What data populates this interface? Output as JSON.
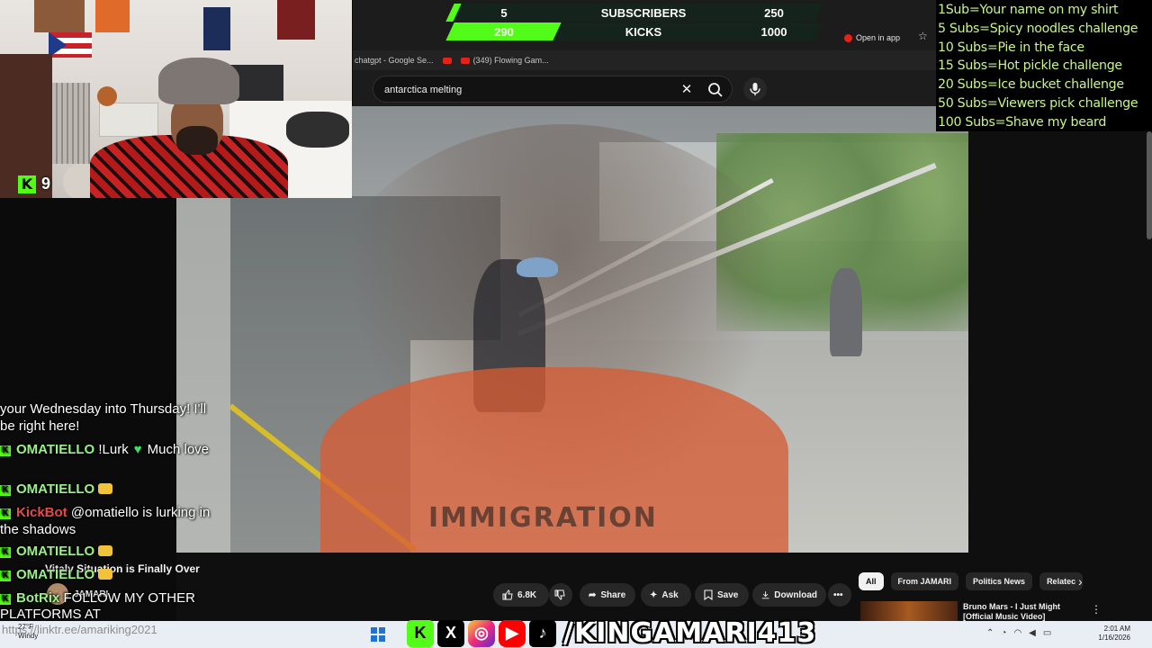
{
  "goal_widget": {
    "subscribers": {
      "current": "5",
      "label": "SUBSCRIBERS",
      "target": "250",
      "progress": 0.02
    },
    "kicks": {
      "current": "290",
      "label": "KICKS",
      "target": "1000",
      "progress": 0.29
    }
  },
  "browser": {
    "bookmarks": [
      {
        "label": "chatgpt - Google Se..."
      },
      {
        "label": ""
      },
      {
        "label": "(349) Flowing Gam..."
      }
    ],
    "open_in_app": "Open in app"
  },
  "search": {
    "value": "antarctica melting",
    "placeholder": "Search"
  },
  "webcam": {
    "viewer_count": "9"
  },
  "goals_list": [
    "1Sub=Your name on my shirt",
    "5 Subs=Spicy noodles challenge",
    "10 Subs=Pie in the face",
    "15 Subs=Hot pickle challenge",
    "20 Subs=Ice bucket challenge",
    "50 Subs=Viewers pick challenge",
    "100 Subs=Shave my beard"
  ],
  "video": {
    "shirt_text": "IMMIGRATION",
    "title": "Vitaly Situation is Finally Over",
    "channel": "JAMARI"
  },
  "chat": {
    "lines": [
      {
        "text": "your Wednesday into Thursday! I'll"
      },
      {
        "text": "be right here!"
      },
      {
        "name": "OMATIELLO",
        "text": "!Lurk",
        "text2": "Much love",
        "name_color": "#9bf08a"
      },
      {
        "name": "OMATIELLO",
        "text": "",
        "name_color": "#9bf08a"
      },
      {
        "name": "KickBot",
        "text": "@omatiello is lurking in",
        "name_color": "#e84a4a"
      },
      {
        "text": "the shadows"
      },
      {
        "name": "OMATIELLO",
        "text": "",
        "name_color": "#9bf08a"
      },
      {
        "name": "OMATIELLO",
        "text": "",
        "name_color": "#9bf08a"
      },
      {
        "name": "BotRix",
        "text": "FOLLOW MY OTHER",
        "name_color": "#9bf08a"
      },
      {
        "text": "PLATFORMS AT"
      },
      {
        "text": "https://linktr.ee/amariking2021"
      }
    ]
  },
  "actions": {
    "like": "6.8K",
    "share": "Share",
    "ask": "Ask",
    "save": "Save",
    "download": "Download"
  },
  "chips": [
    "All",
    "From JAMARI",
    "Politics News",
    "Relatec"
  ],
  "related": {
    "title": "Bruno Mars - I Just Might [Official Music Video]"
  },
  "taskbar": {
    "weather_temp": "27°F",
    "weather_desc": "Windy",
    "time": "2:01 AM",
    "date": "1/16/2026",
    "handle": "/KINGAMARI413"
  },
  "colors": {
    "kick_green": "#53fc18",
    "goal_text": "#c7f58b",
    "yt_red": "#e62117"
  }
}
